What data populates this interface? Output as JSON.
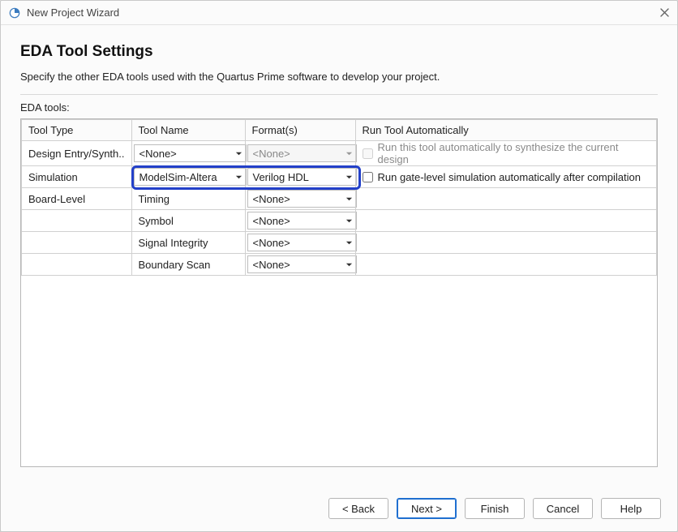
{
  "window": {
    "title": "New Project Wizard"
  },
  "heading": "EDA Tool Settings",
  "description": "Specify the other EDA tools used with the Quartus Prime software to develop your project.",
  "section_label": "EDA tools:",
  "columns": {
    "tool_type": "Tool Type",
    "tool_name": "Tool Name",
    "formats": "Format(s)",
    "run_auto": "Run Tool Automatically"
  },
  "rows": {
    "design_entry": {
      "tool_type": "Design Entry/Synth..",
      "tool_name": "<None>",
      "format": "<None>",
      "format_disabled": true,
      "run_text": "Run this tool automatically to synthesize the current design",
      "run_disabled": true,
      "run_checked": false
    },
    "simulation": {
      "tool_type": "Simulation",
      "tool_name": "ModelSim-Altera",
      "format": "Verilog HDL",
      "format_disabled": false,
      "run_text": "Run gate-level simulation automatically after compilation",
      "run_disabled": false,
      "run_checked": false
    },
    "board": {
      "tool_type": "Board-Level",
      "sub": {
        "timing": {
          "label": "Timing",
          "format": "<None>"
        },
        "symbol": {
          "label": "Symbol",
          "format": "<None>"
        },
        "sigint": {
          "label": "Signal Integrity",
          "format": "<None>"
        },
        "boundary": {
          "label": "Boundary Scan",
          "format": "<None>"
        }
      }
    }
  },
  "buttons": {
    "back": "< Back",
    "next": "Next >",
    "finish": "Finish",
    "cancel": "Cancel",
    "help": "Help"
  }
}
